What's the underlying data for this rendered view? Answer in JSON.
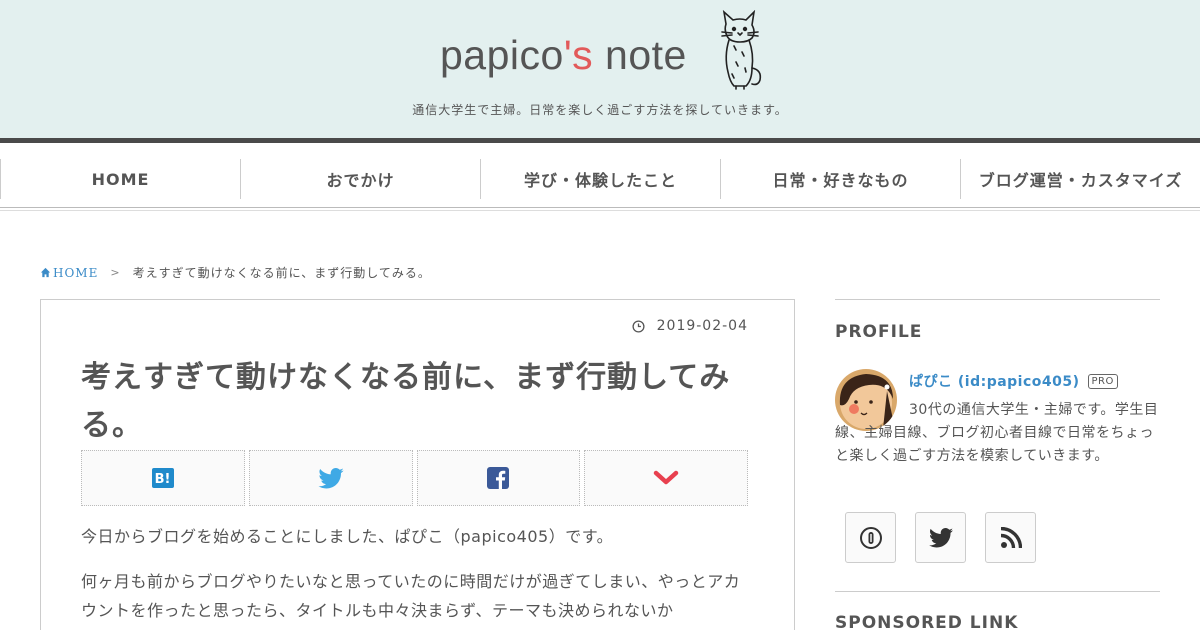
{
  "header": {
    "logo_main": "papico",
    "logo_accent": "'s",
    "logo_tail": " note",
    "tagline": "通信大学生で主婦。日常を楽しく過ごす方法を探していきます。"
  },
  "nav": {
    "items": [
      {
        "label": "HOME"
      },
      {
        "label": "おでかけ"
      },
      {
        "label": "学び・体験したこと"
      },
      {
        "label": "日常・好きなもの"
      },
      {
        "label": "ブログ運営・カスタマイズ"
      }
    ]
  },
  "breadcrumb": {
    "home_label": "HOME",
    "separator": ">",
    "current": "考えすぎて動けなくなる前に、まず行動してみる。"
  },
  "article": {
    "date": "2019-02-04",
    "title": "考えすぎて動けなくなる前に、まず行動してみる。",
    "share_buttons": [
      {
        "icon": "hatena-bookmark-icon",
        "color": "#1f8acb"
      },
      {
        "icon": "twitter-icon",
        "color": "#3fa9e5"
      },
      {
        "icon": "facebook-icon",
        "color": "#3b5998"
      },
      {
        "icon": "pocket-icon",
        "color": "#e8404f"
      }
    ],
    "paragraphs": [
      "今日からブログを始めることにしました、ぱぴこ（papico405）です。",
      "何ヶ月も前からブログやりたいなと思っていたのに時間だけが過ぎてしまい、やっとアカウントを作ったと思ったら、タイトルも中々決まらず、テーマも決められないか"
    ]
  },
  "sidebar": {
    "profile_title": "PROFILE",
    "profile_name": "ぱぴこ (id:papico405)",
    "pro_badge": "PRO",
    "profile_desc_first": "30代の通信大学生・主婦です。学生目線、主婦目線、ブログ初心者目線で日常をちょっと楽しく過ごす方法を模索していきます。",
    "follow_buttons": [
      {
        "icon": "hatena-subscribe-icon"
      },
      {
        "icon": "twitter-icon"
      },
      {
        "icon": "rss-icon"
      }
    ],
    "sponsored_title": "SPONSORED LINK"
  },
  "colors": {
    "header_bg": "#e3f0ef",
    "accent": "#e25a5a",
    "link": "#3b8bc7"
  }
}
